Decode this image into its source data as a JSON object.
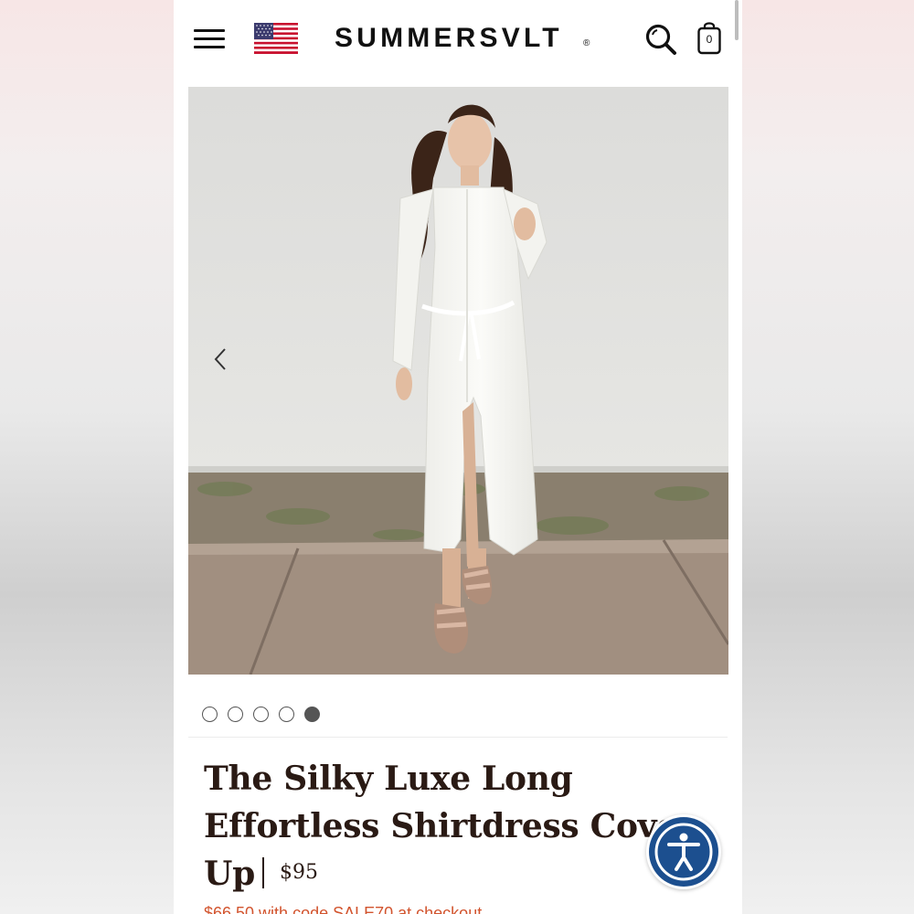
{
  "header": {
    "brand": "SUMMERSVLT",
    "brand_mark": "®",
    "cart_count": "0",
    "icons": [
      "menu-icon",
      "us-flag-icon",
      "search-icon",
      "shopping-bag-icon"
    ]
  },
  "gallery": {
    "total_slides": 5,
    "active_slide": 5,
    "prev_icon": "chevron-left-icon"
  },
  "product": {
    "title": "The Silky Luxe Long Effortless Shirtdress Cover Up",
    "price": "$95",
    "sale_text": "$66.50 with code SALE70 at checkout"
  },
  "colors": {
    "price_sale": "#d2542e",
    "title_text": "#2a1a14",
    "a11y_blue": "#1c4f8f",
    "dot_active": "#555555"
  },
  "accessibility": {
    "icon": "accessibility-icon"
  }
}
